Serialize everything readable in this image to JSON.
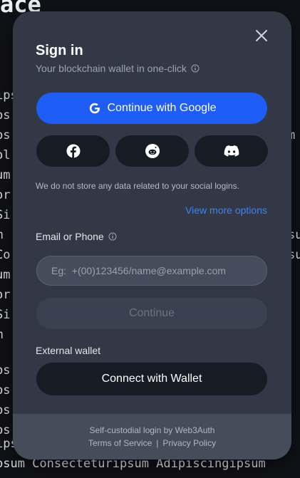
{
  "background": {
    "title": "ace",
    "lines": [
      "ips",
      "ps",
      "ps",
      "ol",
      "um",
      "or",
      "Si",
      "m",
      "Co",
      "um",
      "or",
      "Si",
      "m",
      "ps",
      "ps",
      "ps",
      "ps",
      "ips",
      "psum Consecteturipsum Adipiscingipsum"
    ],
    "right_fragments": [
      "m",
      "su",
      "su"
    ]
  },
  "modal": {
    "title": "Sign in",
    "subtitle": "Your blockchain wallet in one-click",
    "google_button": "Continue with Google",
    "social_icons": [
      "facebook-icon",
      "reddit-icon",
      "discord-icon"
    ],
    "note": "We do not store any data related to your social logins.",
    "more_link": "View more options",
    "email_label": "Email or Phone",
    "email_placeholder": "Eg:  +(00)123456/name@example.com",
    "continue_button": "Continue",
    "external_label": "External wallet",
    "wallet_button": "Connect with Wallet",
    "footer": {
      "line1": "Self-custodial login by Web3Auth",
      "terms": "Terms of Service",
      "separator": "|",
      "privacy": "Privacy Policy"
    }
  },
  "colors": {
    "accent": "#1e5ef6",
    "link": "#3d82f6",
    "modal_bg": "#323846",
    "button_dark": "#171b24"
  }
}
